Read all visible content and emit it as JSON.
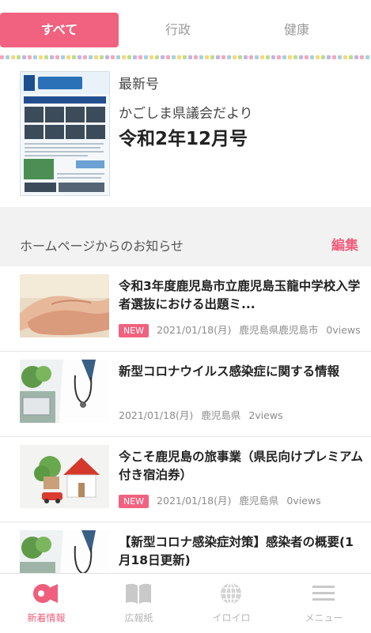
{
  "tabs": [
    {
      "label": "すべて",
      "active": true
    },
    {
      "label": "行政",
      "active": false
    },
    {
      "label": "健康",
      "active": false
    }
  ],
  "latest": {
    "label": "最新号",
    "magazine": "かごしま県議会だより",
    "issue": "令和2年12月号"
  },
  "notice": {
    "title": "ホームページからのお知らせ",
    "edit_label": "編集"
  },
  "items": [
    {
      "title": "令和3年度鹿児島市立鹿児島玉龍中学校入学者選抜における出題ミ...",
      "new": "NEW",
      "date": "2021/01/18(月)",
      "source": "鹿児島県鹿児島市",
      "views": "0views",
      "thumb": "hands"
    },
    {
      "title": "新型コロナウイルス感染症に関する情報",
      "new": "",
      "date": "2021/01/18(月)",
      "source": "鹿児島県",
      "views": "2views",
      "thumb": "doctor"
    },
    {
      "title": "今こそ鹿児島の旅事業（県民向けプレミアム付き宿泊券）",
      "new": "NEW",
      "date": "2021/01/18(月)",
      "source": "鹿児島県",
      "views": "0views",
      "thumb": "house"
    },
    {
      "title": "【新型コロナ感染症対策】感染者の概要(1月18日更新)",
      "new": "",
      "date": "",
      "source": "",
      "views": "",
      "thumb": "doctor"
    }
  ],
  "nav": [
    {
      "label": "新着情報",
      "icon": "megaphone-icon",
      "active": true
    },
    {
      "label": "広報紙",
      "icon": "book-icon",
      "active": false
    },
    {
      "label": "イロイロ",
      "icon": "globe-icon",
      "active": false
    },
    {
      "label": "メニュー",
      "icon": "hamburger-icon",
      "active": false
    }
  ],
  "colors": {
    "accent": "#f0627f"
  }
}
